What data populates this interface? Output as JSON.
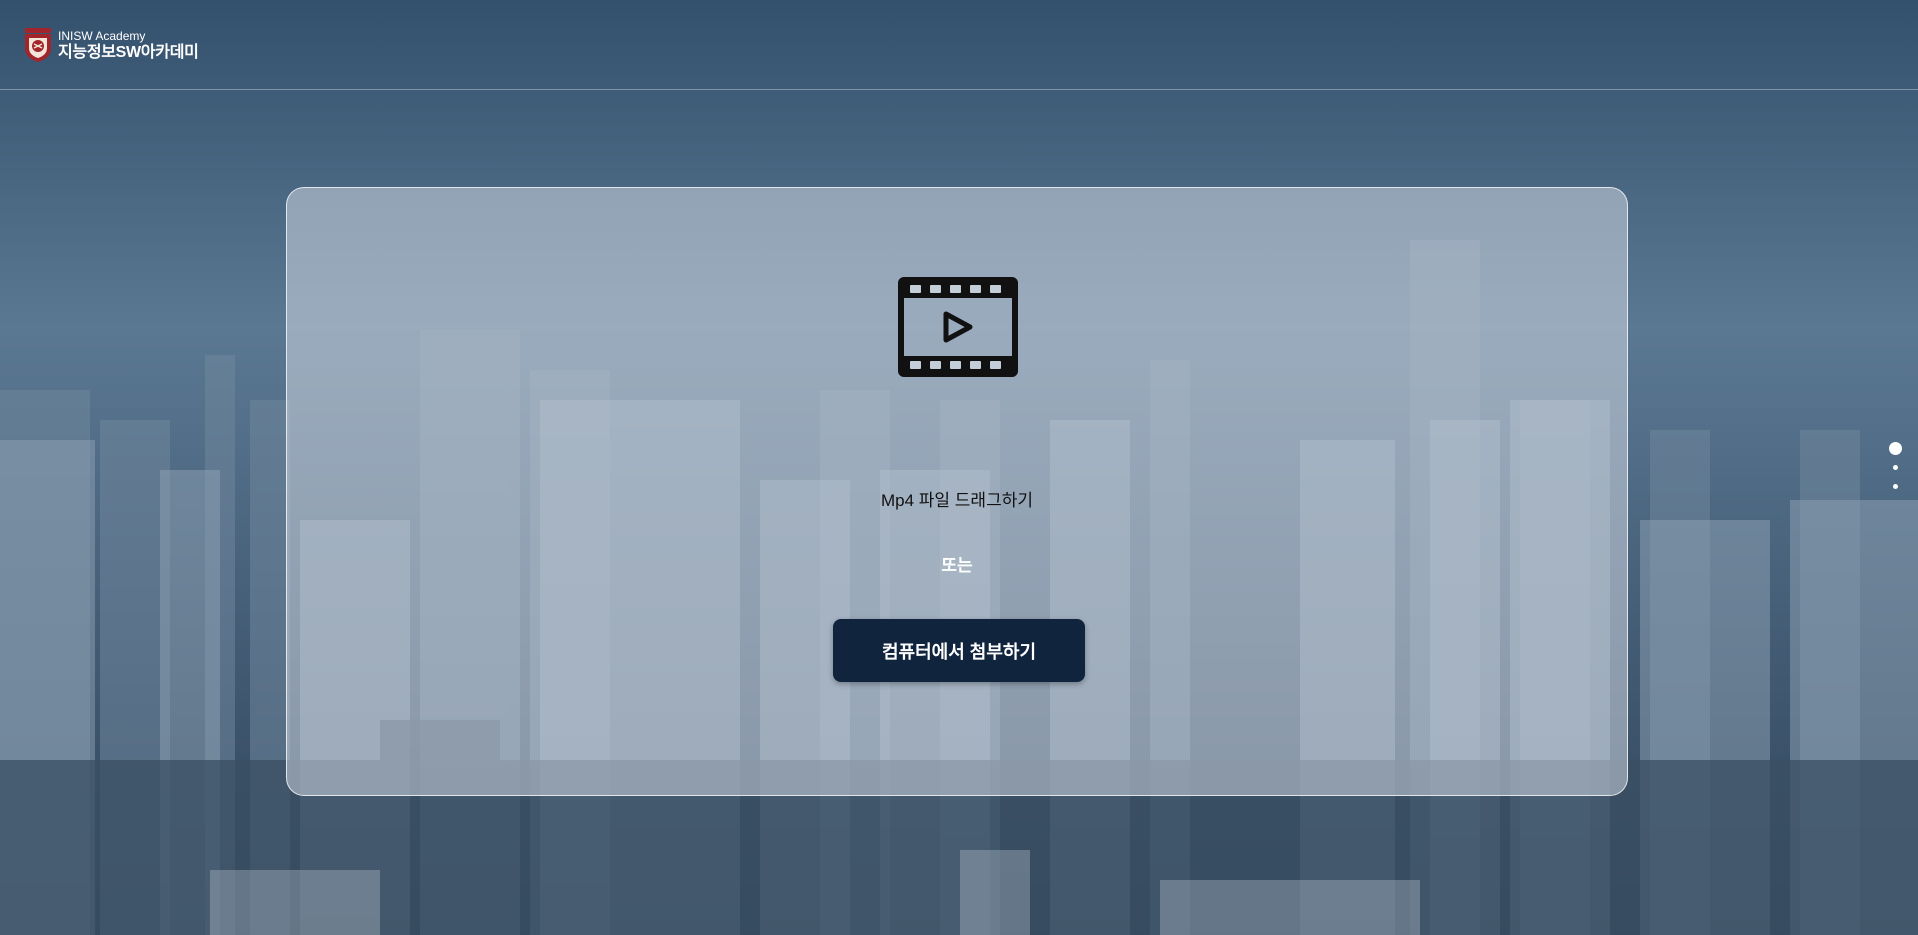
{
  "header": {
    "logo_sub": "INISW Academy",
    "logo_main": "지능정보SW아카데미",
    "emblem_icon": "university-crest-icon"
  },
  "upload": {
    "icon": "video-film-icon",
    "drag_text": "Mp4 파일 드래그하기",
    "or_text": "또는",
    "attach_button_label": "컴퓨터에서 첨부하기"
  },
  "pagination": {
    "dots": 3,
    "active_index": 0
  },
  "colors": {
    "button_bg": "#10243e",
    "card_bg": "#cdd6e0",
    "crest_red": "#a3252c"
  }
}
